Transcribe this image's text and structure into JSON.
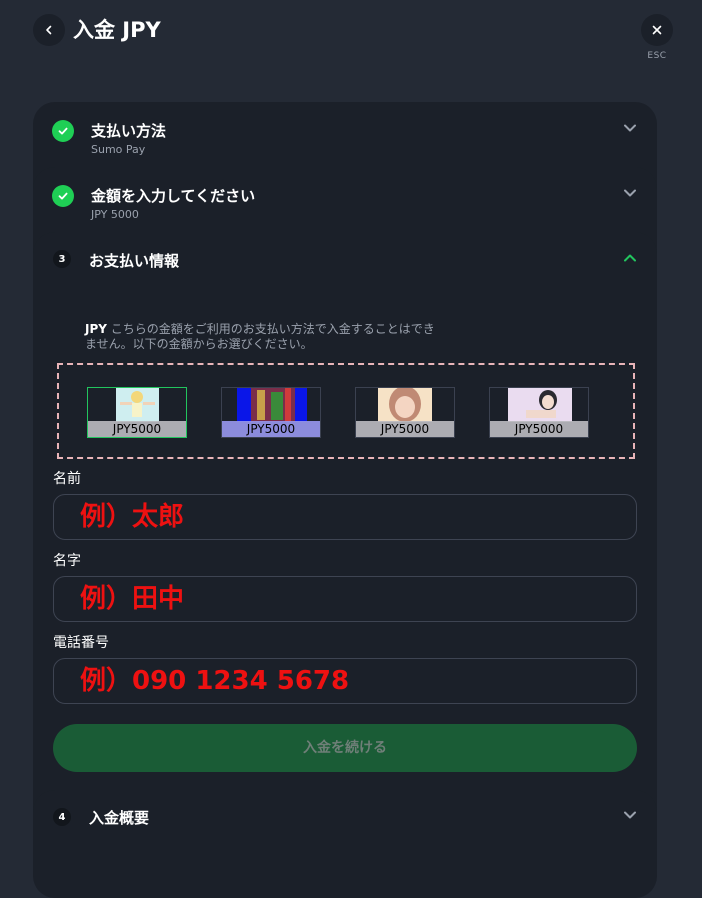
{
  "header": {
    "title": "入金 JPY",
    "esc_label": "ESC"
  },
  "steps": [
    {
      "title": "支払い方法",
      "subtitle": "Sumo Pay"
    },
    {
      "title": "金額を入力してください",
      "subtitle": "JPY 5000"
    },
    {
      "number": "3",
      "title": "お支払い情報"
    },
    {
      "number": "4",
      "title": "入金概要"
    }
  ],
  "payment_info": {
    "currency": "JPY",
    "notice": "こちらの金額をご利用のお支払い方法で入金することはできません。以下の金額からお選びください。",
    "amount_options": [
      {
        "label": "JPY5000",
        "selected": true
      },
      {
        "label": "JPY5000",
        "selected": false
      },
      {
        "label": "JPY5000",
        "selected": false
      },
      {
        "label": "JPY5000",
        "selected": false
      }
    ],
    "fields": [
      {
        "label": "名前",
        "placeholder": "例）太郎"
      },
      {
        "label": "名字",
        "placeholder": "例）田中"
      },
      {
        "label": "電話番号",
        "placeholder": "例）090 1234 5678"
      }
    ],
    "submit_label": "入金を続ける"
  },
  "colors": {
    "background": "#242a35",
    "panel": "#1b2029",
    "success": "#1fcf55",
    "accent": "#22c55e",
    "submit_button": "#1a5c36",
    "placeholder": "#ee1111"
  }
}
